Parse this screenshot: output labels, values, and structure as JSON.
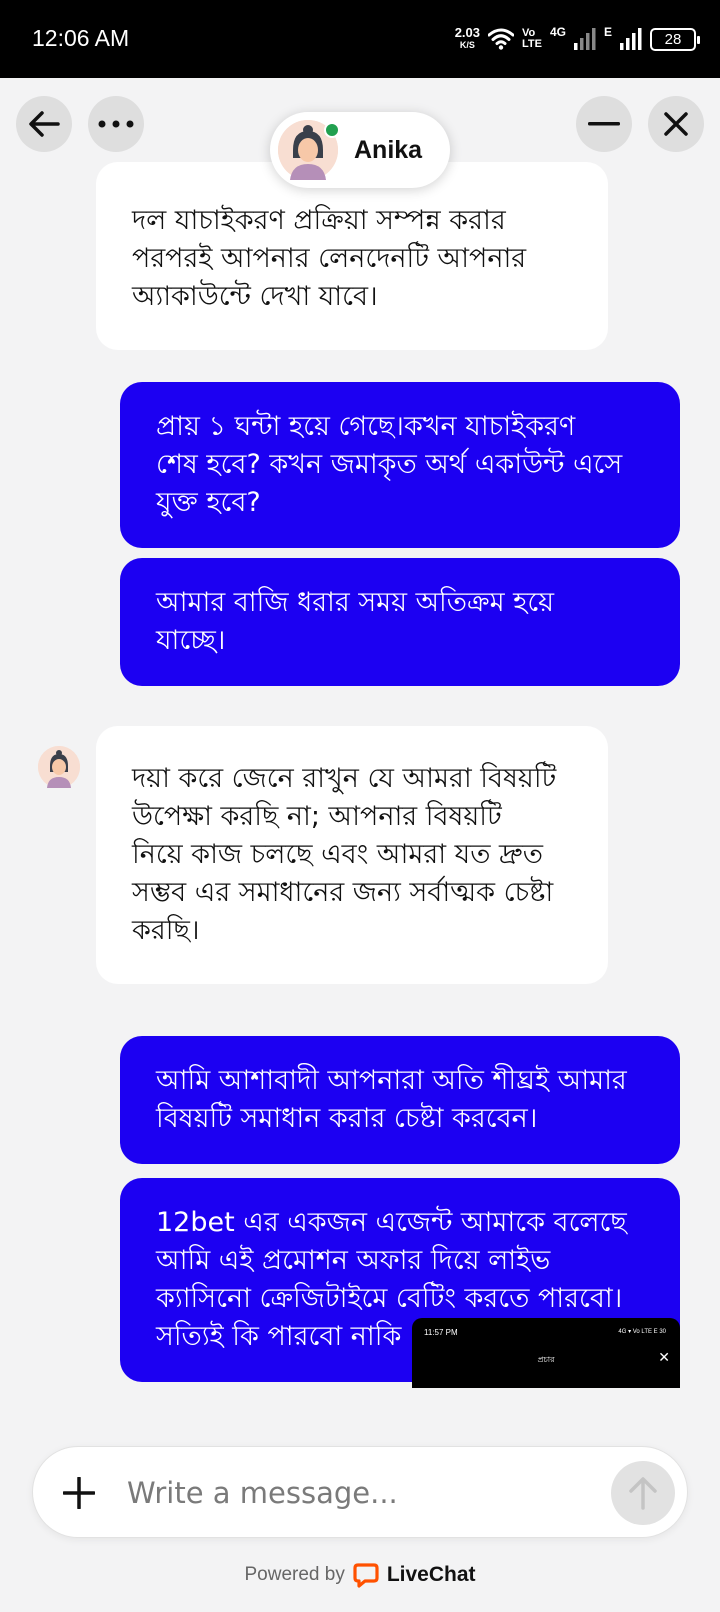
{
  "status_bar": {
    "time": "12:06 AM",
    "net_speed": "2.03",
    "net_unit": "K/S",
    "volte_top": "Vo",
    "volte_bottom": "LTE",
    "net_4g": "4G",
    "net_e": "E",
    "battery": "28"
  },
  "header": {
    "agent_name": "Anika",
    "agent_online": true,
    "icons": [
      "back-arrow-icon",
      "more-dots-icon",
      "minimize-icon",
      "close-icon"
    ]
  },
  "messages": [
    {
      "from": "agent",
      "text": "দল যাচাইকরণ প্রক্রিয়া সম্পন্ন করার\nপরপরই আপনার লেনদেনটি আপনার\nঅ্যাকাউন্টে দেখা যাবে।"
    },
    {
      "from": "user",
      "text": "প্রায় ১ ঘন্টা হয়ে গেছে।কখন যাচাইকরণ\nশেষ হবে? কখন জমাকৃত অর্থ একাউন্ট এসে\nযুক্ত হবে?"
    },
    {
      "from": "user",
      "text": "আমার বাজি ধরার সময় অতিক্রম হয়ে\nযাচ্ছে।"
    },
    {
      "from": "agent",
      "text": "দয়া করে জেনে রাখুন যে আমরা বিষয়টি\nউপেক্ষা করছি না; আপনার বিষয়টি\nনিয়ে কাজ চলছে এবং আমরা যত দ্রুত\nসম্ভব এর সমাধানের জন্য সর্বাত্মক চেষ্টা\nকরছি।"
    },
    {
      "from": "user",
      "text": "আমি আশাবাদী আপনারা অতি শীঘ্রই আমার\nবিষয়টি সমাধান করার চেষ্টা করবেন।"
    },
    {
      "from": "user",
      "text": "12bet এর একজন এজেন্ট আমাকে বলেছে\nআমি এই প্রমোশন অফার দিয়ে লাইভ\nক্যাসিনো ক্রেজিটাইমে বেটিং করতে পারবো।\nসত্যিই কি পারবো নাকি কোনো বাধা আছে?"
    }
  ],
  "attachment": {
    "time": "11:57 PM",
    "status_icons": "4G ▾ Vo LTE E 30",
    "title": "প্রচার"
  },
  "composer": {
    "placeholder": "Write a message..."
  },
  "footer": {
    "powered_by": "Powered by",
    "brand": "LiveChat",
    "brand_color": "#ff5100"
  },
  "colors": {
    "user_bubble": "#1c00f2",
    "agent_bubble": "#ffffff",
    "background": "#f3f3f4",
    "online_dot": "#21a04f"
  }
}
